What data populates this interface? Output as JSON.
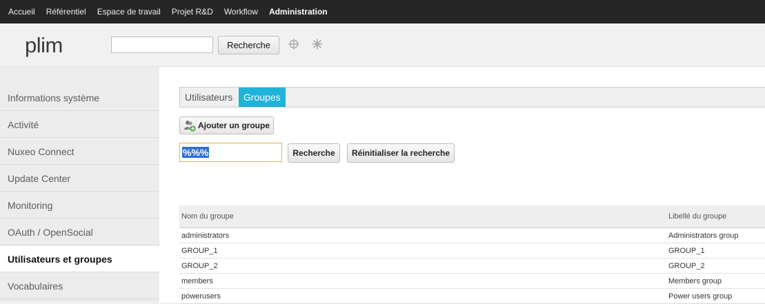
{
  "topnav": {
    "items": [
      "Accueil",
      "Référentiel",
      "Espace de travail",
      "Projet R&D",
      "Workflow",
      "Administration"
    ],
    "active": "Administration"
  },
  "header": {
    "logo": "plim",
    "search_placeholder": "",
    "search_value": "",
    "search_button": "Recherche",
    "icons": [
      "crosshair-icon",
      "sun-icon"
    ]
  },
  "sidebar": {
    "items": [
      {
        "label": "Informations système"
      },
      {
        "label": "Activité"
      },
      {
        "label": "Nuxeo Connect"
      },
      {
        "label": "Update Center"
      },
      {
        "label": "Monitoring"
      },
      {
        "label": "OAuth / OpenSocial"
      },
      {
        "label": "Utilisateurs et groupes"
      },
      {
        "label": "Vocabulaires"
      }
    ],
    "active_index": 6
  },
  "main": {
    "tabs": [
      "Utilisateurs",
      "Groupes"
    ],
    "active_tab": "Groupes",
    "add_button": "Ajouter un groupe",
    "query_value": "%%%",
    "search_button": "Recherche",
    "reset_button": "Réinitialiser la recherche",
    "table": {
      "headers": [
        "Nom du groupe",
        "Libellé du groupe"
      ],
      "rows": [
        [
          "administrators",
          "Administrators group"
        ],
        [
          "GROUP_1",
          "GROUP_1"
        ],
        [
          "GROUP_2",
          "GROUP_2"
        ],
        [
          "members",
          "Members group"
        ],
        [
          "powerusers",
          "Power users group"
        ]
      ]
    }
  },
  "colors": {
    "topnav_bg": "#262626",
    "tab_active": "#1fb3d9",
    "selection": "#2f6fd1"
  }
}
